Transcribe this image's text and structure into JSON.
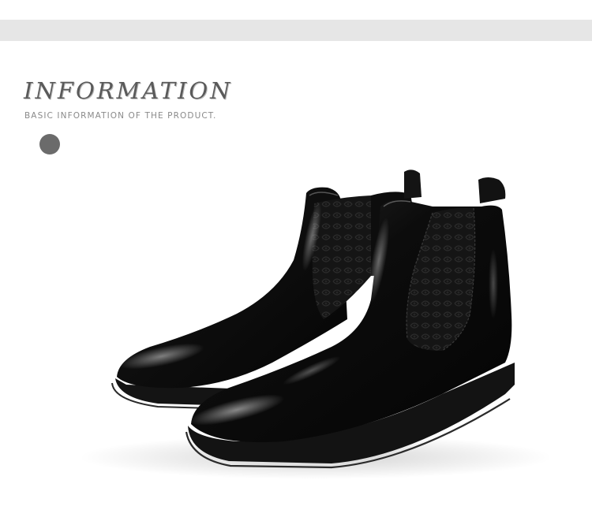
{
  "section": {
    "title": "INFORMATION",
    "subtitle": "BASIC INFORMATION OF THE PRODUCT."
  },
  "colors": {
    "band": "#e6e6e6",
    "title": "#5a5a5a",
    "subtitle": "#8a8a8a",
    "dot": "#6b6b6b",
    "leather": "#0b0b0b"
  },
  "image": {
    "subject": "pair of black patent leather chelsea boots"
  }
}
